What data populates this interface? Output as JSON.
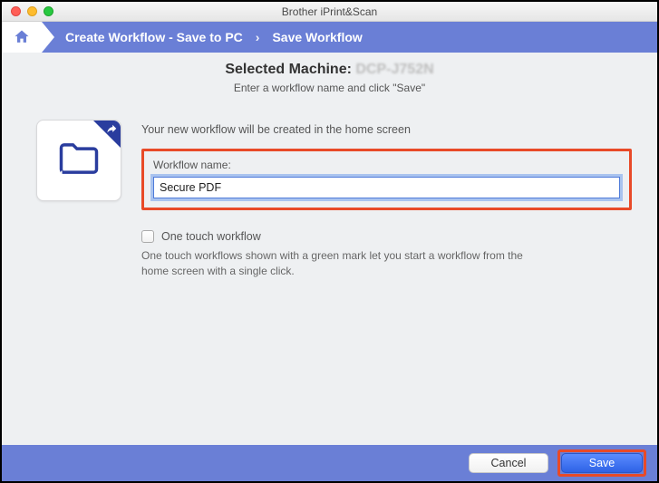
{
  "window": {
    "title": "Brother iPrint&Scan"
  },
  "breadcrumb": {
    "step1": "Create Workflow - Save to PC",
    "step2": "Save Workflow"
  },
  "header": {
    "selected_label": "Selected Machine:",
    "model": "DCP-J752N",
    "subtitle": "Enter a workflow name and click \"Save\""
  },
  "form": {
    "info": "Your new workflow will be created in the home screen",
    "name_label": "Workflow name:",
    "name_value": "Secure PDF",
    "one_touch_label": "One touch workflow",
    "one_touch_desc": "One touch workflows shown with a green mark let you start a workflow from the home screen with a single click."
  },
  "footer": {
    "cancel": "Cancel",
    "save": "Save"
  }
}
